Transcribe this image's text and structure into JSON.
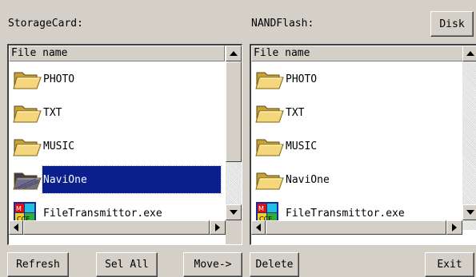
{
  "left_pane": {
    "label": "StorageCard:",
    "column_header": "File name",
    "items": [
      {
        "name": "PHOTO",
        "icon": "folder-icon",
        "selected": false
      },
      {
        "name": "TXT",
        "icon": "folder-icon",
        "selected": false
      },
      {
        "name": "MUSIC",
        "icon": "folder-icon",
        "selected": false
      },
      {
        "name": "NaviOne",
        "icon": "folder-icon",
        "selected": true
      },
      {
        "name": "FileTransmittor.exe",
        "icon": "exe-icon",
        "selected": false
      }
    ]
  },
  "right_pane": {
    "label": "NANDFlash:",
    "column_header": "File name",
    "items": [
      {
        "name": "PHOTO",
        "icon": "folder-icon",
        "selected": false
      },
      {
        "name": "TXT",
        "icon": "folder-icon",
        "selected": false
      },
      {
        "name": "MUSIC",
        "icon": "folder-icon",
        "selected": false
      },
      {
        "name": "NaviOne",
        "icon": "folder-icon",
        "selected": false
      },
      {
        "name": "FileTransmittor.exe",
        "icon": "exe-icon",
        "selected": false
      }
    ]
  },
  "buttons": {
    "disk": "Disk",
    "refresh": "Refresh",
    "sel_all": "Sel All",
    "move": "Move->",
    "delete": "Delete",
    "exit": "Exit"
  },
  "colors": {
    "background": "#d4d0c8",
    "selection": "#0a1e8c",
    "folder": "#f5d67a"
  }
}
